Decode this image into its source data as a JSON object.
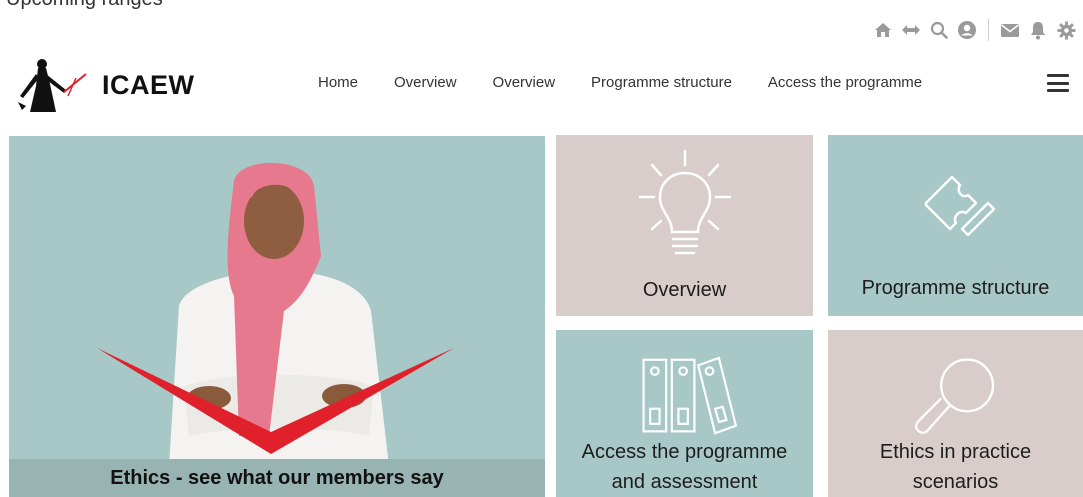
{
  "partial_top_text": "Upcoming ranges",
  "utility_icons": [
    "home-icon",
    "arrows-horizontal-icon",
    "search-icon",
    "user-circle-icon",
    "mail-icon",
    "bell-icon",
    "gear-icon"
  ],
  "logo": {
    "text": "ICAEW"
  },
  "nav": [
    {
      "label": "Home"
    },
    {
      "label": "Overview"
    },
    {
      "label": "Overview"
    },
    {
      "label": "Programme structure"
    },
    {
      "label": "Access the programme"
    }
  ],
  "hero": {
    "caption": "Ethics - see what our members say"
  },
  "tiles": {
    "overview": {
      "label": "Overview",
      "icon": "lightbulb-icon"
    },
    "structure": {
      "label": "Programme structure",
      "icon": "puzzle-piece-icon"
    },
    "access": {
      "line1": "Access the programme",
      "line2": "and assessment",
      "icon": "binders-icon"
    },
    "scenarios": {
      "line1": "Ethics in practice",
      "line2": "scenarios",
      "icon": "magnifier-icon"
    }
  },
  "colors": {
    "teal": "#a8c8c7",
    "taupe": "#d8cdcb",
    "accent_red": "#e0202a"
  }
}
